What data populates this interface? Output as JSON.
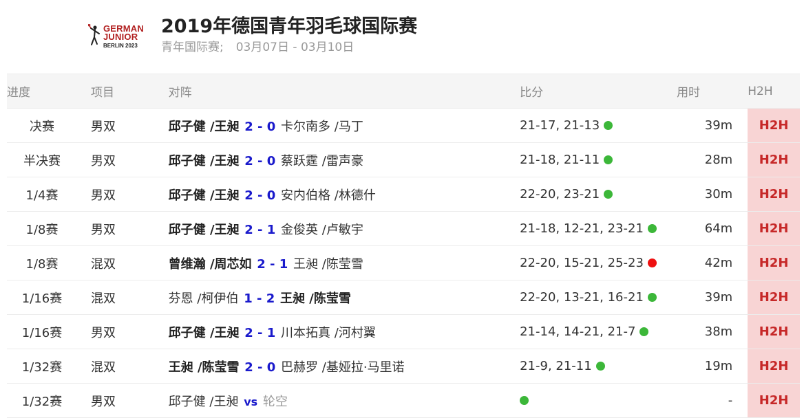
{
  "header": {
    "logo": {
      "line1": "GERMAN",
      "line2": "JUNIOR",
      "line3": "BERLIN 2023"
    },
    "title": "2019年德国青年羽毛球国际赛",
    "category": "青年国际赛;",
    "dates": "03月07日 - 03月10日"
  },
  "columns": {
    "round": "进度",
    "event": "项目",
    "match": "对阵",
    "score": "比分",
    "duration": "用时",
    "h2h": "H2H"
  },
  "colors": {
    "h2h_bg": "#f8d4d4",
    "h2h_text": "#c62828",
    "score_blue": "#1a1acc",
    "dot_green": "#3cb739",
    "dot_red": "#ee1111"
  },
  "matches": [
    {
      "round": "决赛",
      "event": "男双",
      "team1": "邱子健 /王昶",
      "result": "2 - 0",
      "team2": "卡尔南多 /马丁",
      "winner": 1,
      "score": "21-17, 21-13",
      "status": "green",
      "duration": "39m",
      "h2h": "H2H"
    },
    {
      "round": "半决赛",
      "event": "男双",
      "team1": "邱子健 /王昶",
      "result": "2 - 0",
      "team2": "蔡跃霆 /雷声豪",
      "winner": 1,
      "score": "21-18, 21-11",
      "status": "green",
      "duration": "28m",
      "h2h": "H2H"
    },
    {
      "round": "1/4赛",
      "event": "男双",
      "team1": "邱子健 /王昶",
      "result": "2 - 0",
      "team2": "安内伯格 /林德什",
      "winner": 1,
      "score": "22-20, 23-21",
      "status": "green",
      "duration": "30m",
      "h2h": "H2H"
    },
    {
      "round": "1/8赛",
      "event": "男双",
      "team1": "邱子健 /王昶",
      "result": "2 - 1",
      "team2": "金俊英 /卢敏宇",
      "winner": 1,
      "score": "21-18, 12-21, 23-21",
      "status": "green",
      "duration": "64m",
      "h2h": "H2H"
    },
    {
      "round": "1/8赛",
      "event": "混双",
      "team1": "曾维瀚 /周芯如",
      "result": "2 - 1",
      "team2": "王昶 /陈莹雪",
      "winner": 1,
      "score": "22-20, 15-21, 25-23",
      "status": "red",
      "duration": "42m",
      "h2h": "H2H"
    },
    {
      "round": "1/16赛",
      "event": "混双",
      "team1": "芬恩 /柯伊伯",
      "result": "1 - 2",
      "team2": "王昶 /陈莹雪",
      "winner": 2,
      "score": "22-20, 13-21, 16-21",
      "status": "green",
      "duration": "39m",
      "h2h": "H2H"
    },
    {
      "round": "1/16赛",
      "event": "男双",
      "team1": "邱子健 /王昶",
      "result": "2 - 1",
      "team2": "川本拓真 /河村翼",
      "winner": 1,
      "score": "21-14, 14-21, 21-7",
      "status": "green",
      "duration": "38m",
      "h2h": "H2H"
    },
    {
      "round": "1/32赛",
      "event": "混双",
      "team1": "王昶 /陈莹雪",
      "result": "2 - 0",
      "team2": "巴赫罗 /基娅拉·马里诺",
      "winner": 1,
      "score": "21-9, 21-11",
      "status": "green",
      "duration": "19m",
      "h2h": "H2H"
    },
    {
      "round": "1/32赛",
      "event": "男双",
      "team1": "邱子健 /王昶",
      "result": "vs",
      "team2": "轮空",
      "winner": 0,
      "score": "",
      "status": "green",
      "duration": "-",
      "h2h": "H2H"
    }
  ]
}
